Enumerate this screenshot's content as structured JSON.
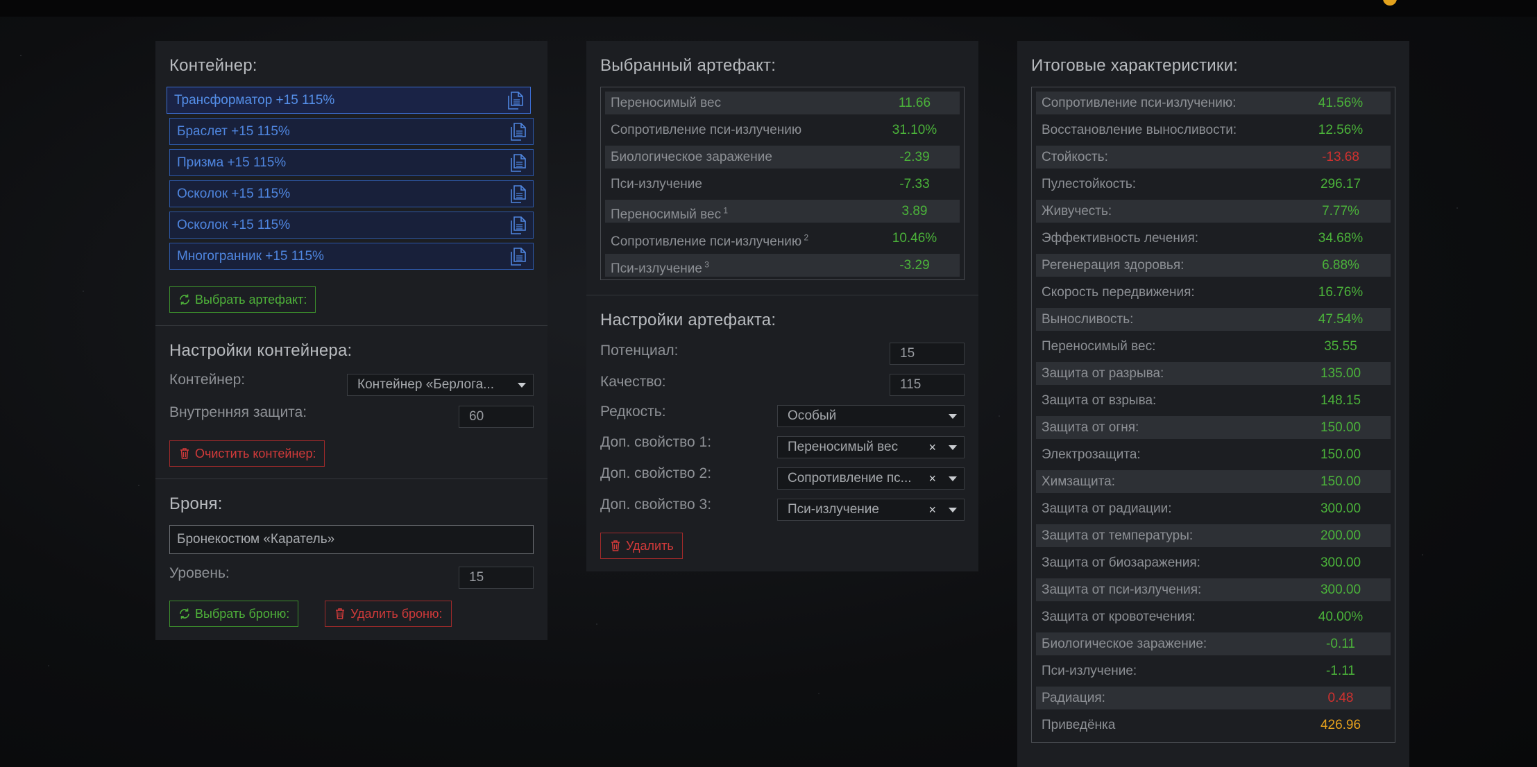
{
  "colors": {
    "green": "#4bb33a",
    "red": "#d0312f",
    "gold": "#e6a11d",
    "blue": "#4f86e0"
  },
  "container": {
    "title": "Контейнер:",
    "slots": [
      {
        "label": "Трансформатор +15 115%"
      },
      {
        "label": "Браслет +15 115%"
      },
      {
        "label": "Призма +15 115%"
      },
      {
        "label": "Осколок +15 115%"
      },
      {
        "label": "Осколок +15 115%"
      },
      {
        "label": "Многогранник +15 115%"
      }
    ],
    "select_button": "Выбрать артефакт:"
  },
  "container_settings": {
    "title": "Настройки контейнера:",
    "container_label": "Контейнер:",
    "container_value": "Контейнер «Берлога...",
    "protection_label": "Внутренняя защита:",
    "protection_value": "60",
    "clear_button": "Очистить контейнер:"
  },
  "armor": {
    "title": "Броня:",
    "armor_value": "Бронекостюм «Каратель»",
    "level_label": "Уровень:",
    "level_value": "15",
    "select_button": "Выбрать броню:",
    "delete_button": "Удалить броню:"
  },
  "selected_artifact": {
    "title": "Выбранный артефакт:",
    "rows": [
      {
        "name": "Переносимый вес",
        "sup": "",
        "value": "11.66",
        "color": "green"
      },
      {
        "name": "Сопротивление пси-излучению",
        "sup": "",
        "value": "31.10%",
        "color": "green"
      },
      {
        "name": "Биологическое заражение",
        "sup": "",
        "value": "-2.39",
        "color": "green"
      },
      {
        "name": "Пси-излучение",
        "sup": "",
        "value": "-7.33",
        "color": "green"
      },
      {
        "name": "Переносимый вес",
        "sup": "1",
        "value": "3.89",
        "color": "green"
      },
      {
        "name": "Сопротивление пси-излучению",
        "sup": "2",
        "value": "10.46%",
        "color": "green"
      },
      {
        "name": "Пси-излучение",
        "sup": "3",
        "value": "-3.29",
        "color": "green"
      }
    ]
  },
  "artifact_settings": {
    "title": "Настройки артефакта:",
    "potential_label": "Потенциал:",
    "potential_value": "15",
    "quality_label": "Качество:",
    "quality_value": "115",
    "rarity_label": "Редкость:",
    "rarity_value": "Особый",
    "extra1_label": "Доп. свойство 1:",
    "extra1_value": "Переносимый вес",
    "extra2_label": "Доп. свойство 2:",
    "extra2_value": "Сопротивление пс...",
    "extra3_label": "Доп. свойство 3:",
    "extra3_value": "Пси-излучение",
    "clear_symbol": "×",
    "delete_button": "Удалить"
  },
  "totals": {
    "title": "Итоговые характеристики:",
    "rows": [
      {
        "name": "Сопротивление пси-излучению:",
        "value": "41.56%",
        "color": "green"
      },
      {
        "name": "Восстановление выносливости:",
        "value": "12.56%",
        "color": "green"
      },
      {
        "name": "Стойкость:",
        "value": "-13.68",
        "color": "red"
      },
      {
        "name": "Пулестойкость:",
        "value": "296.17",
        "color": "green"
      },
      {
        "name": "Живучесть:",
        "value": "7.77%",
        "color": "green"
      },
      {
        "name": "Эффективность лечения:",
        "value": "34.68%",
        "color": "green"
      },
      {
        "name": "Регенерация здоровья:",
        "value": "6.88%",
        "color": "green"
      },
      {
        "name": "Скорость передвижения:",
        "value": "16.76%",
        "color": "green"
      },
      {
        "name": "Выносливость:",
        "value": "47.54%",
        "color": "green"
      },
      {
        "name": "Переносимый вес:",
        "value": "35.55",
        "color": "green"
      },
      {
        "name": "Защита от разрыва:",
        "value": "135.00",
        "color": "green"
      },
      {
        "name": "Защита от взрыва:",
        "value": "148.15",
        "color": "green"
      },
      {
        "name": "Защита от огня:",
        "value": "150.00",
        "color": "green"
      },
      {
        "name": "Электрозащита:",
        "value": "150.00",
        "color": "green"
      },
      {
        "name": "Химзащита:",
        "value": "150.00",
        "color": "green"
      },
      {
        "name": "Защита от радиации:",
        "value": "300.00",
        "color": "green"
      },
      {
        "name": "Защита от температуры:",
        "value": "200.00",
        "color": "green"
      },
      {
        "name": "Защита от биозаражения:",
        "value": "300.00",
        "color": "green"
      },
      {
        "name": "Защита от пси-излучения:",
        "value": "300.00",
        "color": "green"
      },
      {
        "name": "Защита от кровотечения:",
        "value": "40.00%",
        "color": "green"
      },
      {
        "name": "Биологическое заражение:",
        "value": "-0.11",
        "color": "green"
      },
      {
        "name": "Пси-излучение:",
        "value": "-1.11",
        "color": "green"
      },
      {
        "name": "Радиация:",
        "value": "0.48",
        "color": "red"
      },
      {
        "name": "Приведёнка",
        "value": "426.96",
        "color": "gold"
      }
    ]
  }
}
